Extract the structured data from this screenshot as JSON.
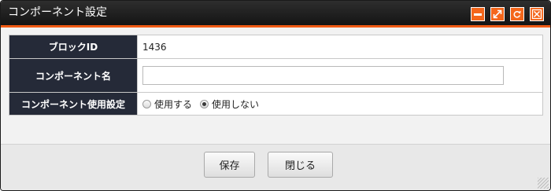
{
  "dialog": {
    "title": "コンポーネント設定",
    "accent_color": "#f05a14",
    "header_bg": "#252a38",
    "title_buttons": [
      "minimize-icon",
      "maximize-icon",
      "refresh-icon",
      "close-icon"
    ]
  },
  "form": {
    "rows": [
      {
        "label": "ブロックID",
        "value": "1436"
      },
      {
        "label": "コンポーネント名",
        "value": ""
      },
      {
        "label": "コンポーネント使用設定"
      }
    ],
    "radio_options": [
      {
        "label": "使用する",
        "checked": false
      },
      {
        "label": "使用しない",
        "checked": true
      }
    ]
  },
  "footer": {
    "save_label": "保存",
    "close_label": "閉じる"
  }
}
